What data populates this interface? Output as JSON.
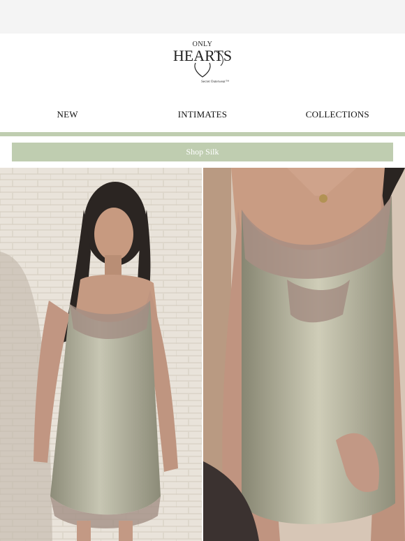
{
  "brand": {
    "logo_line1": "ONLY",
    "logo_line2": "HEARTS",
    "logo_tagline": "Secret Outerwear™"
  },
  "nav": {
    "items": [
      {
        "label": "NEW"
      },
      {
        "label": "INTIMATES"
      },
      {
        "label": "COLLECTIONS"
      }
    ]
  },
  "cta": {
    "label": "Shop Silk"
  },
  "colors": {
    "accent": "#bfcdb0",
    "preheader_bg": "#f4f4f4",
    "silk": "#a9a793"
  },
  "images": [
    {
      "name": "photo-model-silk-slip-full-length"
    },
    {
      "name": "photo-silk-slip-lace-closeup"
    }
  ]
}
